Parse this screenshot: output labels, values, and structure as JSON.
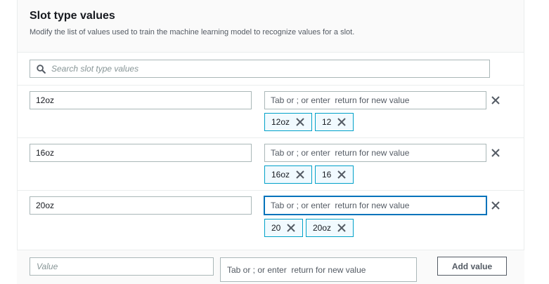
{
  "panel": {
    "title": "Slot type values",
    "description": "Modify the list of values used to train the machine learning model to recognize values for a slot."
  },
  "search": {
    "placeholder": "Search slot type values"
  },
  "synonym_placeholder": "Tab or ; or enter  return for new value",
  "rows": [
    {
      "value": "12oz",
      "synonyms": [
        "12oz",
        "12"
      ]
    },
    {
      "value": "16oz",
      "synonyms": [
        "16oz",
        "16"
      ]
    },
    {
      "value": "20oz",
      "synonyms": [
        "20",
        "20oz"
      ]
    }
  ],
  "add_row": {
    "value_placeholder": "Value",
    "synonym_placeholder": "Tab or ; or enter  return for new value",
    "button_label": "Add value"
  },
  "colors": {
    "token_border": "#00a1c9",
    "token_bg": "#f1faff",
    "focus": "#0073bb"
  }
}
